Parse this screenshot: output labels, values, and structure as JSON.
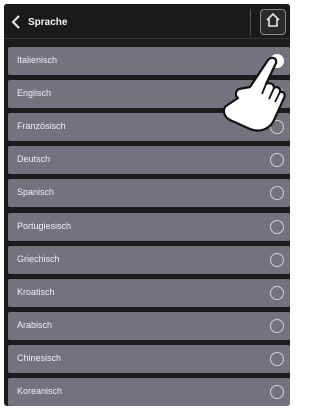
{
  "header": {
    "title": "Sprache"
  },
  "languages": [
    {
      "label": "Italienisch",
      "selected": true
    },
    {
      "label": "Englisch",
      "selected": false
    },
    {
      "label": "Französisch",
      "selected": false
    },
    {
      "label": "Deutsch",
      "selected": false
    },
    {
      "label": "Spanisch",
      "selected": false
    },
    {
      "label": "Portugiesisch",
      "selected": false
    },
    {
      "label": "Griechisch",
      "selected": false
    },
    {
      "label": "Kroatisch",
      "selected": false
    },
    {
      "label": "Arabisch",
      "selected": false
    },
    {
      "label": "Chinesisch",
      "selected": false
    },
    {
      "label": "Koreanisch",
      "selected": false
    }
  ],
  "colors": {
    "row_bg": "#73737f",
    "header_bg": "#1a1a1a",
    "selected_radio": "#ffffff"
  },
  "icons": {
    "back": "chevron-left-icon",
    "home": "home-icon",
    "hand": "pointing-hand-icon"
  }
}
